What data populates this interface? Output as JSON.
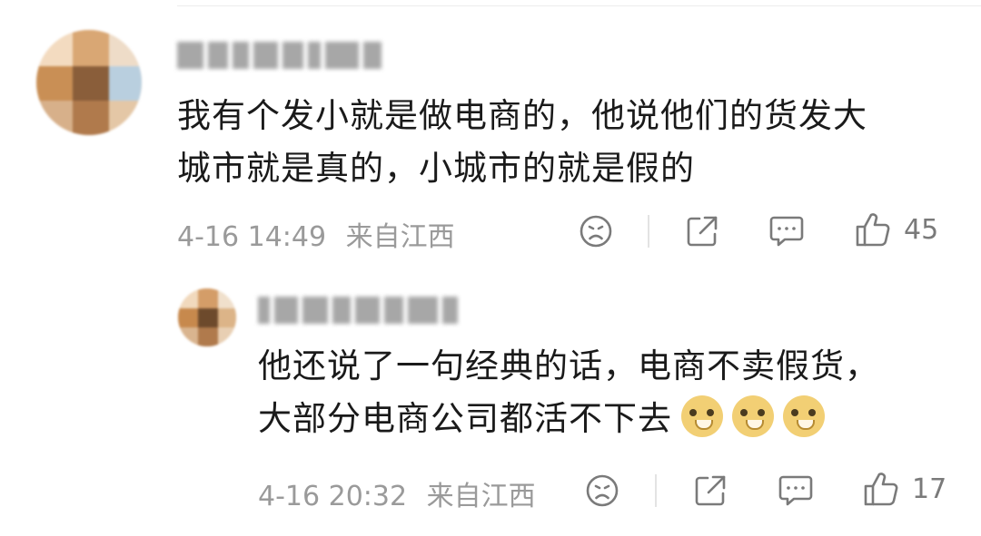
{
  "comments": [
    {
      "text_lines": [
        "我有个发小就是做电商的，他说他们的货发大",
        "城市就是真的，小城市的就是假的"
      ],
      "time": "4-16 14:49",
      "location": "来自江西",
      "likes": "45"
    },
    {
      "text_lines": [
        "他还说了一句经典的话，电商不卖假货，",
        "大部分电商公司都活不下去"
      ],
      "emoji": [
        "doge-emoji",
        "doge-emoji",
        "doge-emoji"
      ],
      "time": "4-16 20:32",
      "location": "来自江西",
      "likes": "17"
    }
  ],
  "icons": [
    "dislike-face-icon",
    "share-icon",
    "comment-icon",
    "thumbs-up-icon"
  ],
  "colors": {
    "text": "#1a1a1a",
    "meta": "#9a9a9a",
    "icon": "#7a7a7a"
  }
}
